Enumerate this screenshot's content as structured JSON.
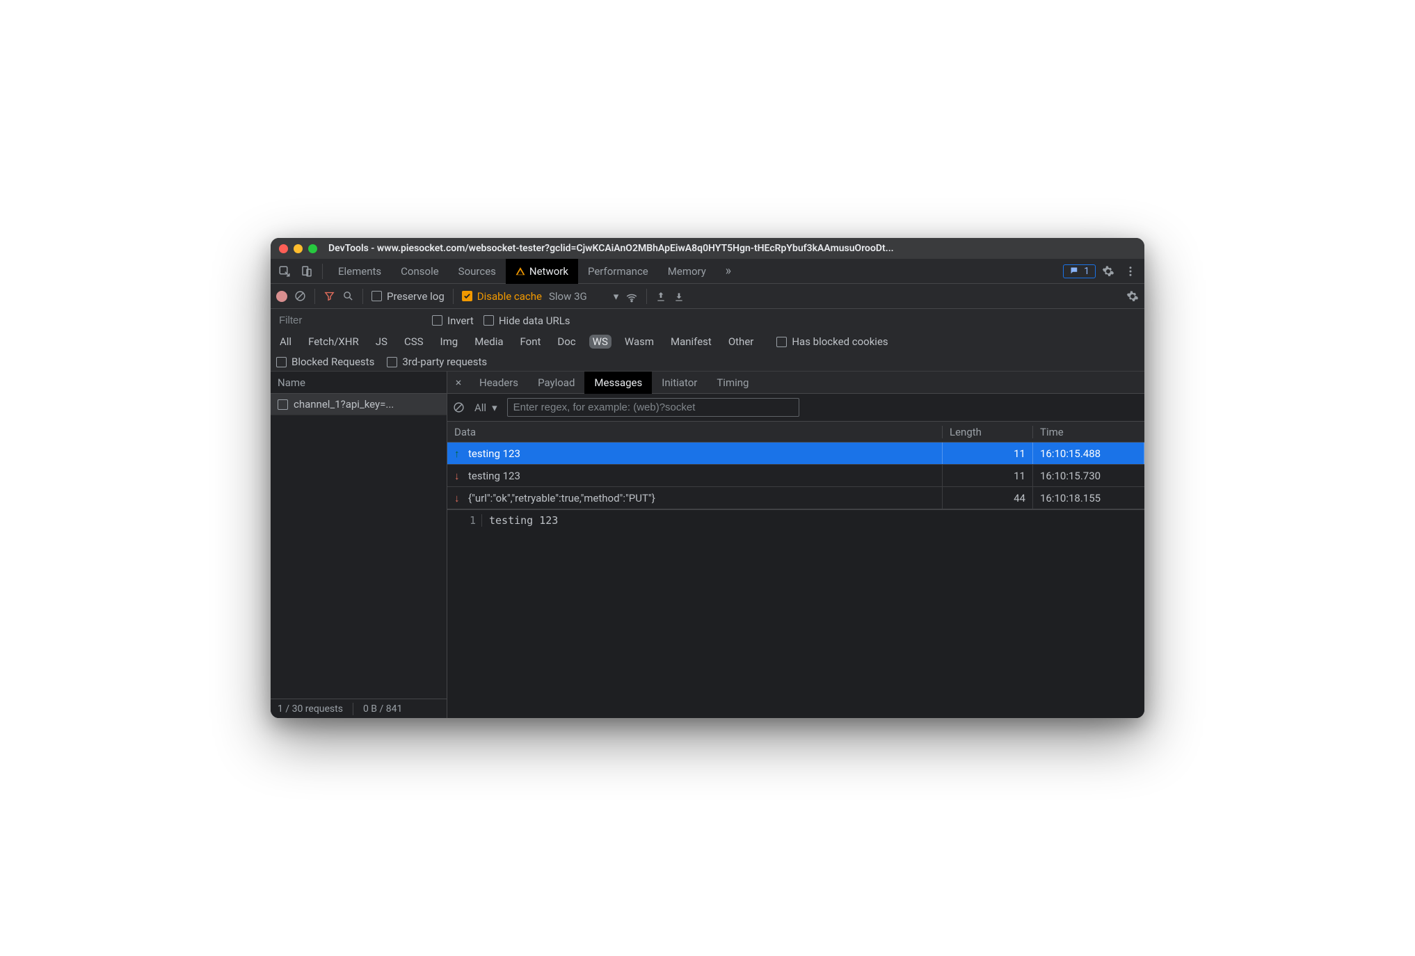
{
  "window": {
    "title": "DevTools - www.piesocket.com/websocket-tester?gclid=CjwKCAiAnO2MBhApEiwA8q0HYT5Hgn-tHEcRpYbuf3kAAmusuOrooDt..."
  },
  "tabs": {
    "items": [
      "Elements",
      "Console",
      "Sources",
      "Network",
      "Performance",
      "Memory"
    ],
    "active": "Network"
  },
  "issues_badge": "1",
  "net_toolbar": {
    "preserve_log": "Preserve log",
    "disable_cache": "Disable cache",
    "throttle": "Slow 3G"
  },
  "filter": {
    "placeholder": "Filter",
    "invert": "Invert",
    "hide_data_urls": "Hide data URLs",
    "types": [
      "All",
      "Fetch/XHR",
      "JS",
      "CSS",
      "Img",
      "Media",
      "Font",
      "Doc",
      "WS",
      "Wasm",
      "Manifest",
      "Other"
    ],
    "active_type": "WS",
    "has_blocked": "Has blocked cookies",
    "blocked_requests": "Blocked Requests",
    "third_party": "3rd-party requests"
  },
  "left": {
    "header": "Name",
    "items": [
      "channel_1?api_key=..."
    ],
    "status": {
      "requests": "1 / 30 requests",
      "transfer": "0 B / 841"
    }
  },
  "detail_tabs": {
    "items": [
      "Headers",
      "Payload",
      "Messages",
      "Initiator",
      "Timing"
    ],
    "active": "Messages"
  },
  "msg_toolbar": {
    "filter_label": "All",
    "regex_placeholder": "Enter regex, for example: (web)?socket"
  },
  "msg_headers": {
    "data": "Data",
    "length": "Length",
    "time": "Time"
  },
  "messages": [
    {
      "dir": "up",
      "data": "testing 123",
      "length": "11",
      "time": "16:10:15.488",
      "selected": true
    },
    {
      "dir": "down",
      "data": "testing 123",
      "length": "11",
      "time": "16:10:15.730",
      "selected": false
    },
    {
      "dir": "down",
      "data": "{\"url\":\"ok\",\"retryable\":true,\"method\":\"PUT\"}",
      "length": "44",
      "time": "16:10:18.155",
      "selected": false
    }
  ],
  "msg_detail": {
    "line_no": "1",
    "content": "testing 123"
  }
}
